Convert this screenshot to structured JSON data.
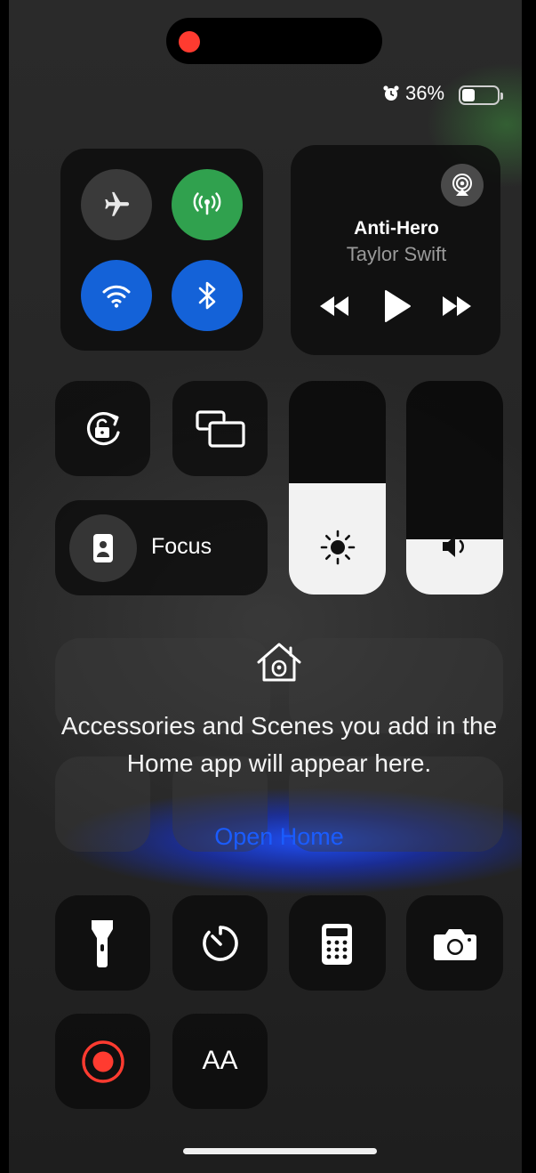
{
  "status_bar": {
    "battery_percent": "36%",
    "battery_level": 0.36,
    "alarm_icon": "alarm-icon"
  },
  "connectivity": {
    "airplane": {
      "icon": "airplane-icon",
      "on": false
    },
    "cellular": {
      "icon": "cellular-antenna-icon",
      "on": true,
      "color": "#30a14e"
    },
    "wifi": {
      "icon": "wifi-icon",
      "on": true,
      "color": "#1462d8"
    },
    "bluetooth": {
      "icon": "bluetooth-icon",
      "on": true,
      "color": "#1462d8"
    }
  },
  "now_playing": {
    "title": "Anti-Hero",
    "artist": "Taylor Swift",
    "controls": [
      "rewind-icon",
      "play-icon",
      "fast-forward-icon"
    ],
    "airplay_icon": "airplay-icon"
  },
  "toggles": {
    "orientation_lock_icon": "orientation-lock-icon",
    "screen_mirroring_icon": "screen-mirroring-icon"
  },
  "focus": {
    "label": "Focus",
    "icon": "focus-person-icon"
  },
  "sliders": {
    "brightness": {
      "icon": "sun-icon",
      "level": 0.52
    },
    "volume": {
      "icon": "speaker-icon",
      "level": 0.26
    }
  },
  "home": {
    "message": "Accessories and Scenes you add in the Home app will appear here.",
    "open_label": "Open Home",
    "open_color": "#1a5cff"
  },
  "shortcuts": [
    "flashlight-icon",
    "timer-icon",
    "calculator-icon",
    "camera-icon",
    "screen-record-icon",
    "text-size-icon"
  ],
  "text_size_label": "AA",
  "accent": {
    "record": "#ff3b30"
  }
}
